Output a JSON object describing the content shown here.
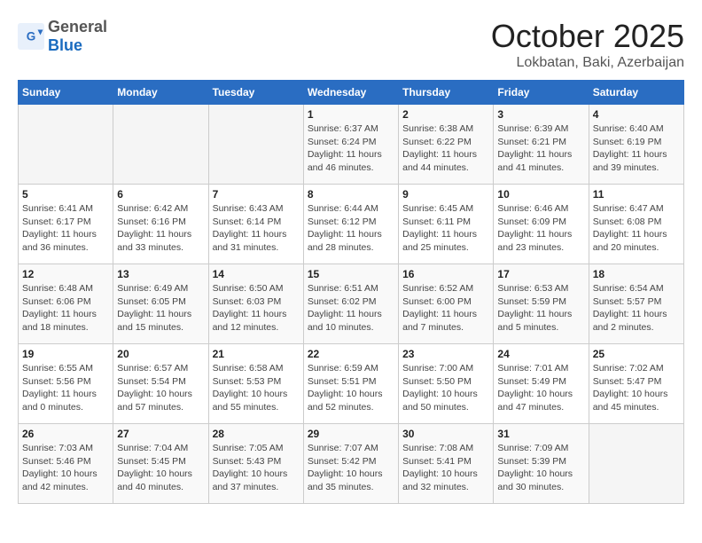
{
  "header": {
    "logo_general": "General",
    "logo_blue": "Blue",
    "month_title": "October 2025",
    "location": "Lokbatan, Baki, Azerbaijan"
  },
  "days_of_week": [
    "Sunday",
    "Monday",
    "Tuesday",
    "Wednesday",
    "Thursday",
    "Friday",
    "Saturday"
  ],
  "weeks": [
    [
      {
        "day": "",
        "info": ""
      },
      {
        "day": "",
        "info": ""
      },
      {
        "day": "",
        "info": ""
      },
      {
        "day": "1",
        "info": "Sunrise: 6:37 AM\nSunset: 6:24 PM\nDaylight: 11 hours and 46 minutes."
      },
      {
        "day": "2",
        "info": "Sunrise: 6:38 AM\nSunset: 6:22 PM\nDaylight: 11 hours and 44 minutes."
      },
      {
        "day": "3",
        "info": "Sunrise: 6:39 AM\nSunset: 6:21 PM\nDaylight: 11 hours and 41 minutes."
      },
      {
        "day": "4",
        "info": "Sunrise: 6:40 AM\nSunset: 6:19 PM\nDaylight: 11 hours and 39 minutes."
      }
    ],
    [
      {
        "day": "5",
        "info": "Sunrise: 6:41 AM\nSunset: 6:17 PM\nDaylight: 11 hours and 36 minutes."
      },
      {
        "day": "6",
        "info": "Sunrise: 6:42 AM\nSunset: 6:16 PM\nDaylight: 11 hours and 33 minutes."
      },
      {
        "day": "7",
        "info": "Sunrise: 6:43 AM\nSunset: 6:14 PM\nDaylight: 11 hours and 31 minutes."
      },
      {
        "day": "8",
        "info": "Sunrise: 6:44 AM\nSunset: 6:12 PM\nDaylight: 11 hours and 28 minutes."
      },
      {
        "day": "9",
        "info": "Sunrise: 6:45 AM\nSunset: 6:11 PM\nDaylight: 11 hours and 25 minutes."
      },
      {
        "day": "10",
        "info": "Sunrise: 6:46 AM\nSunset: 6:09 PM\nDaylight: 11 hours and 23 minutes."
      },
      {
        "day": "11",
        "info": "Sunrise: 6:47 AM\nSunset: 6:08 PM\nDaylight: 11 hours and 20 minutes."
      }
    ],
    [
      {
        "day": "12",
        "info": "Sunrise: 6:48 AM\nSunset: 6:06 PM\nDaylight: 11 hours and 18 minutes."
      },
      {
        "day": "13",
        "info": "Sunrise: 6:49 AM\nSunset: 6:05 PM\nDaylight: 11 hours and 15 minutes."
      },
      {
        "day": "14",
        "info": "Sunrise: 6:50 AM\nSunset: 6:03 PM\nDaylight: 11 hours and 12 minutes."
      },
      {
        "day": "15",
        "info": "Sunrise: 6:51 AM\nSunset: 6:02 PM\nDaylight: 11 hours and 10 minutes."
      },
      {
        "day": "16",
        "info": "Sunrise: 6:52 AM\nSunset: 6:00 PM\nDaylight: 11 hours and 7 minutes."
      },
      {
        "day": "17",
        "info": "Sunrise: 6:53 AM\nSunset: 5:59 PM\nDaylight: 11 hours and 5 minutes."
      },
      {
        "day": "18",
        "info": "Sunrise: 6:54 AM\nSunset: 5:57 PM\nDaylight: 11 hours and 2 minutes."
      }
    ],
    [
      {
        "day": "19",
        "info": "Sunrise: 6:55 AM\nSunset: 5:56 PM\nDaylight: 11 hours and 0 minutes."
      },
      {
        "day": "20",
        "info": "Sunrise: 6:57 AM\nSunset: 5:54 PM\nDaylight: 10 hours and 57 minutes."
      },
      {
        "day": "21",
        "info": "Sunrise: 6:58 AM\nSunset: 5:53 PM\nDaylight: 10 hours and 55 minutes."
      },
      {
        "day": "22",
        "info": "Sunrise: 6:59 AM\nSunset: 5:51 PM\nDaylight: 10 hours and 52 minutes."
      },
      {
        "day": "23",
        "info": "Sunrise: 7:00 AM\nSunset: 5:50 PM\nDaylight: 10 hours and 50 minutes."
      },
      {
        "day": "24",
        "info": "Sunrise: 7:01 AM\nSunset: 5:49 PM\nDaylight: 10 hours and 47 minutes."
      },
      {
        "day": "25",
        "info": "Sunrise: 7:02 AM\nSunset: 5:47 PM\nDaylight: 10 hours and 45 minutes."
      }
    ],
    [
      {
        "day": "26",
        "info": "Sunrise: 7:03 AM\nSunset: 5:46 PM\nDaylight: 10 hours and 42 minutes."
      },
      {
        "day": "27",
        "info": "Sunrise: 7:04 AM\nSunset: 5:45 PM\nDaylight: 10 hours and 40 minutes."
      },
      {
        "day": "28",
        "info": "Sunrise: 7:05 AM\nSunset: 5:43 PM\nDaylight: 10 hours and 37 minutes."
      },
      {
        "day": "29",
        "info": "Sunrise: 7:07 AM\nSunset: 5:42 PM\nDaylight: 10 hours and 35 minutes."
      },
      {
        "day": "30",
        "info": "Sunrise: 7:08 AM\nSunset: 5:41 PM\nDaylight: 10 hours and 32 minutes."
      },
      {
        "day": "31",
        "info": "Sunrise: 7:09 AM\nSunset: 5:39 PM\nDaylight: 10 hours and 30 minutes."
      },
      {
        "day": "",
        "info": ""
      }
    ]
  ]
}
